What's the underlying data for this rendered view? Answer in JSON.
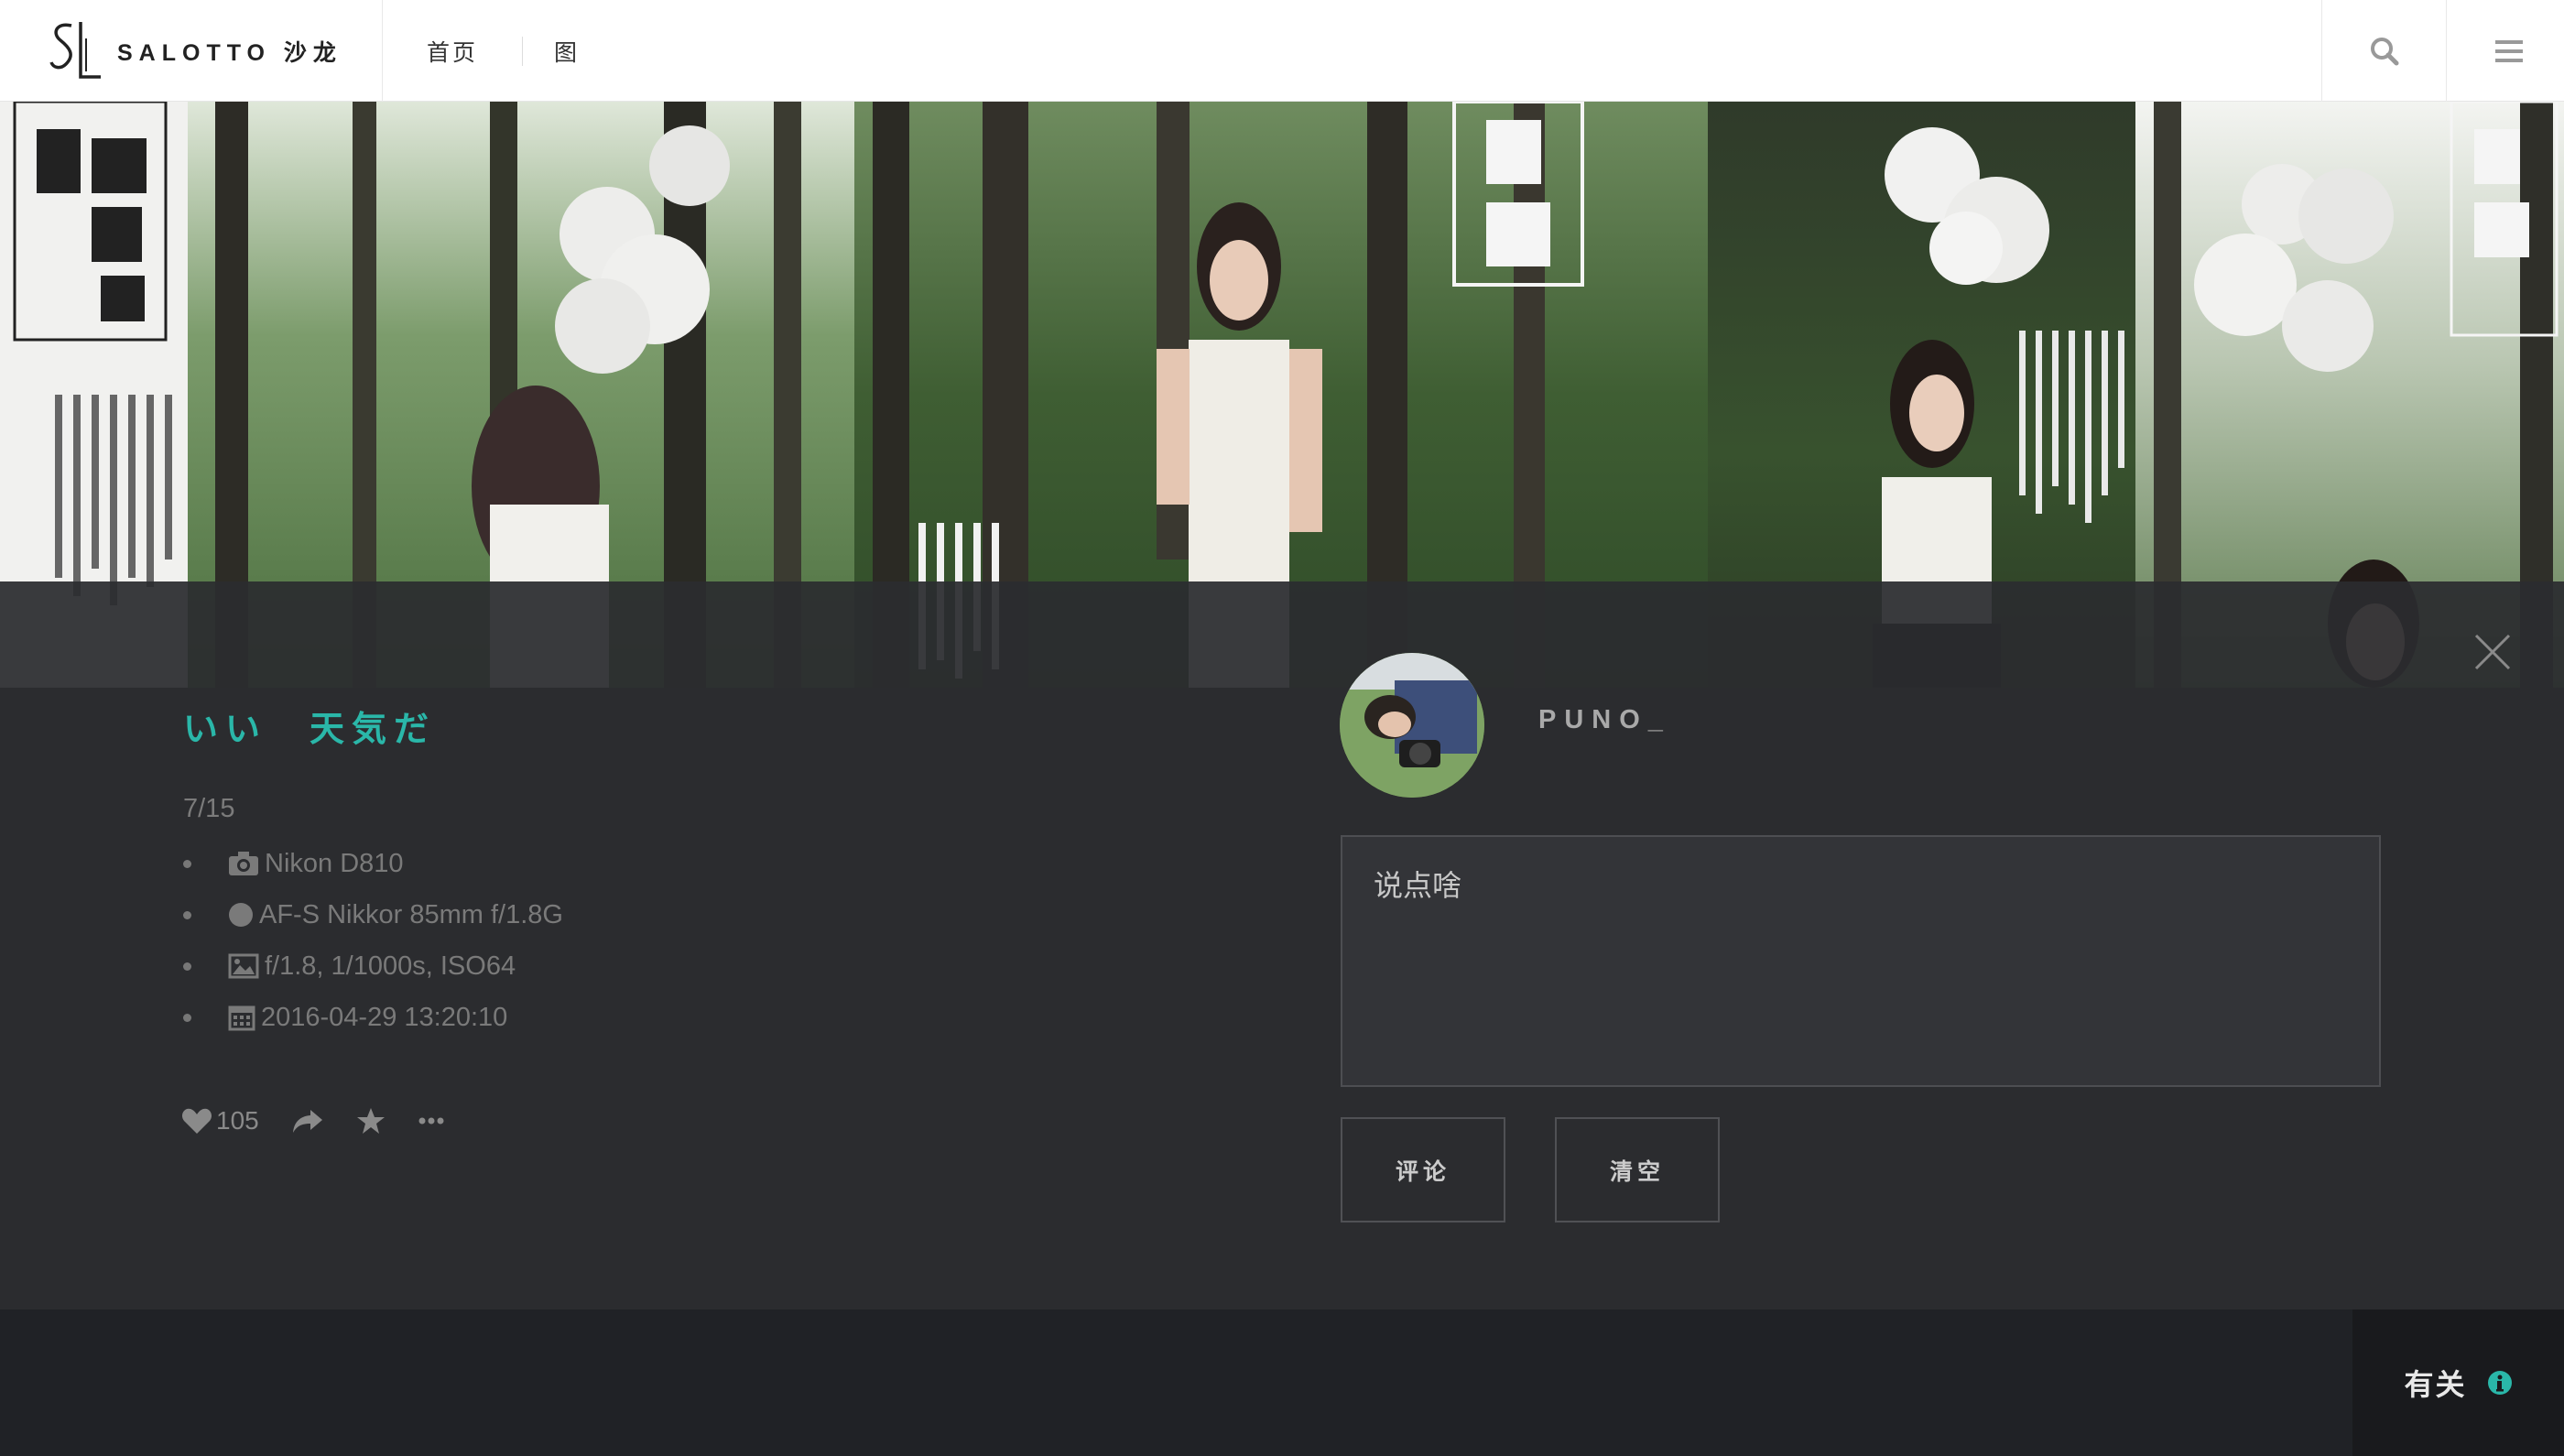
{
  "brand": {
    "name": "SALOTTO 沙龙"
  },
  "nav": {
    "items": [
      "首页",
      "图"
    ]
  },
  "photo": {
    "title": "いい　天気だ",
    "index": "7/15",
    "camera": "Nikon D810",
    "lens": "AF-S Nikkor 85mm f/1.8G",
    "exposure": "f/1.8, 1/1000s, ISO64",
    "datetime": "2016-04-29 13:20:10",
    "likes": "105"
  },
  "author": {
    "username": "PUNO_"
  },
  "comment": {
    "placeholder": "说点啥",
    "submit_label": "评论",
    "clear_label": "清空"
  },
  "footer": {
    "about_label": "有关"
  },
  "colors": {
    "accent": "#2ab7a9",
    "panel_bg": "#2b2c2f",
    "footer_bg": "#202226",
    "header_bg": "#ffffff"
  },
  "icons": [
    "search-icon",
    "menu-icon",
    "close-icon",
    "camera-icon",
    "lens-icon",
    "image-icon",
    "calendar-icon",
    "heart-icon",
    "share-icon",
    "star-icon",
    "more-icon",
    "info-icon"
  ]
}
